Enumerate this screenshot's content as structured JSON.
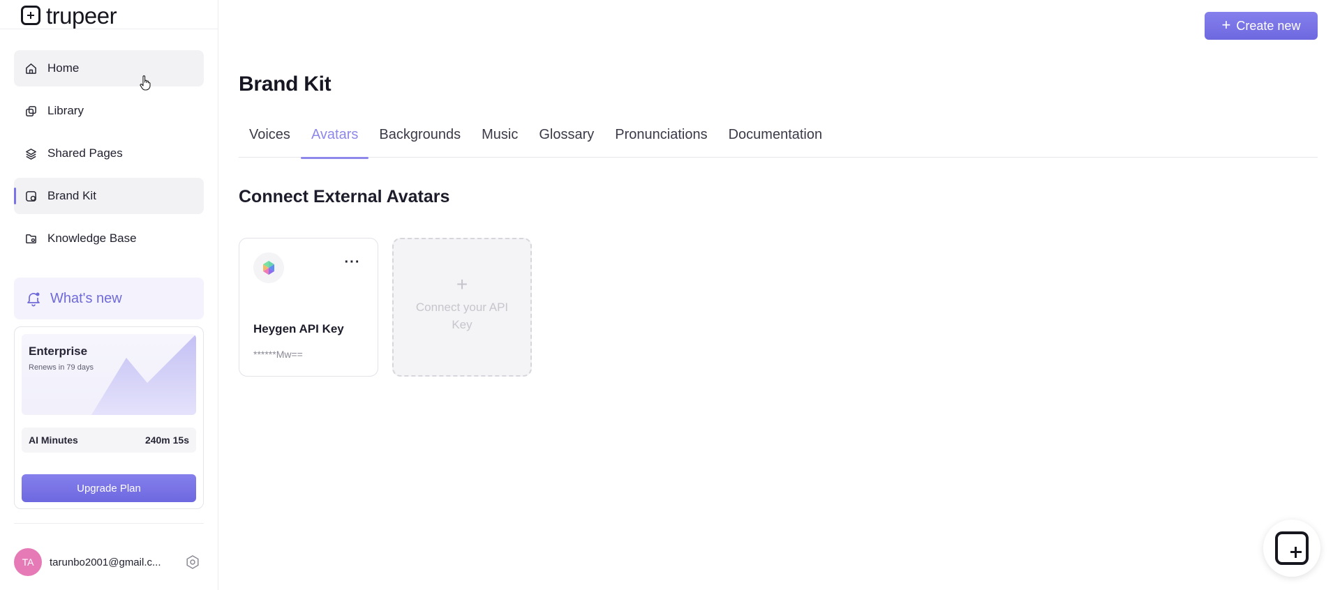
{
  "app": {
    "logo_text": "trupeer"
  },
  "sidebar": {
    "items": [
      {
        "label": "Home",
        "icon": "home-icon"
      },
      {
        "label": "Library",
        "icon": "library-icon"
      },
      {
        "label": "Shared Pages",
        "icon": "layers-icon"
      },
      {
        "label": "Brand Kit",
        "icon": "brand-kit-icon"
      },
      {
        "label": "Knowledge Base",
        "icon": "folder-icon"
      }
    ],
    "whats_new": "What's new",
    "plan": {
      "name": "Enterprise",
      "renews": "Renews in 79 days",
      "minutes_label": "AI Minutes",
      "minutes_value": "240m 15s",
      "upgrade_label": "Upgrade Plan"
    },
    "user": {
      "initials": "TA",
      "email": "tarunbo2001@gmail.c..."
    }
  },
  "header": {
    "create_label": "Create new"
  },
  "main": {
    "title": "Brand Kit",
    "tabs": [
      {
        "label": "Voices"
      },
      {
        "label": "Avatars"
      },
      {
        "label": "Backgrounds"
      },
      {
        "label": "Music"
      },
      {
        "label": "Glossary"
      },
      {
        "label": "Pronunciations"
      },
      {
        "label": "Documentation"
      }
    ],
    "active_tab": "Avatars",
    "section_title": "Connect External Avatars",
    "cards": [
      {
        "name": "Heygen API Key",
        "key": "******Mw=="
      }
    ],
    "connect_label": "Connect your API Key"
  },
  "colors": {
    "accent": "#7a74e6",
    "active_tab": "#8d88ea",
    "avatar_bg": "#e67ab7"
  }
}
